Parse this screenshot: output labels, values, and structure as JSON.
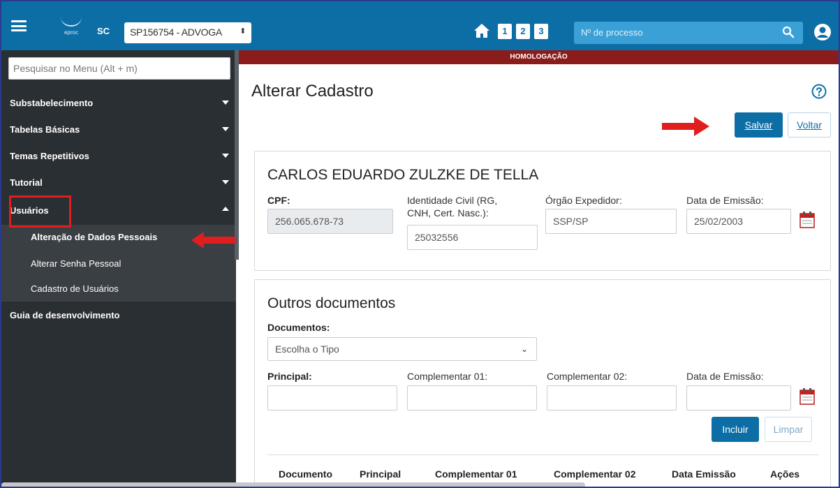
{
  "topbar": {
    "logo_text": "eproc",
    "uf": "SC",
    "profile": "SP156754 - ADVOGA",
    "quick_buttons": [
      "1",
      "2",
      "3"
    ],
    "process_search_placeholder": "Nº de processo"
  },
  "banner": "HOMOLOGAÇÃO",
  "sidebar": {
    "search_placeholder": "Pesquisar no Menu (Alt + m)",
    "items": [
      {
        "label": "Substabelecimento"
      },
      {
        "label": "Tabelas Básicas"
      },
      {
        "label": "Temas Repetitivos"
      },
      {
        "label": "Tutorial"
      },
      {
        "label": "Usuários"
      }
    ],
    "submenu": [
      {
        "label": "Alteração de Dados Pessoais"
      },
      {
        "label": "Alterar Senha Pessoal"
      },
      {
        "label": "Cadastro de Usuários"
      }
    ],
    "footer_item": "Guia de desenvolvimento"
  },
  "page": {
    "title": "Alterar Cadastro",
    "save": "Salvar",
    "back": "Voltar"
  },
  "person": {
    "name": "CARLOS EDUARDO ZULZKE DE TELLA",
    "cpf_label": "CPF:",
    "cpf": "256.065.678-73",
    "id_label_1": "Identidade Civil (RG,",
    "id_label_2": "CNH, Cert. Nasc.):",
    "id_value": "25032556",
    "issuer_label": "Órgão Expedidor:",
    "issuer_value": "SSP/SP",
    "issue_date_label": "Data de Emissão:",
    "issue_date_value": "25/02/2003"
  },
  "other_docs": {
    "title": "Outros documentos",
    "docs_label": "Documentos:",
    "docs_select": "Escolha o Tipo",
    "principal_label": "Principal:",
    "comp1_label": "Complementar 01:",
    "comp2_label": "Complementar 02:",
    "date_label": "Data de Emissão:",
    "include": "Incluir",
    "clear": "Limpar",
    "table_headers": [
      "Documento",
      "Principal",
      "Complementar 01",
      "Complementar 02",
      "Data Emissão",
      "Ações"
    ]
  },
  "colors": {
    "topbar": "#0d6ea6",
    "sidebar": "#2a2f33",
    "banner": "#8b1c1c",
    "highlight": "#e01e1e"
  }
}
